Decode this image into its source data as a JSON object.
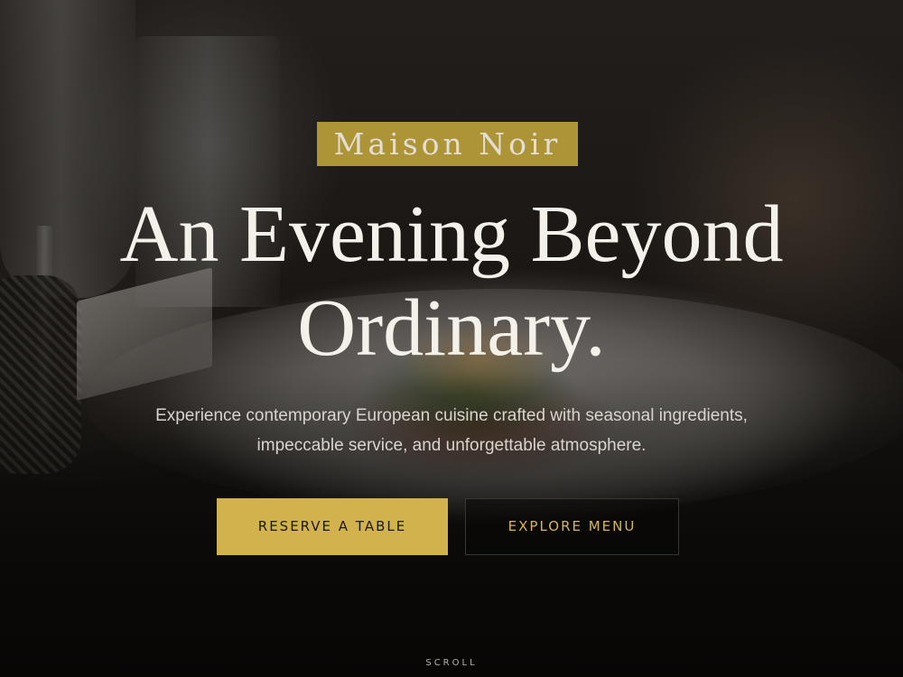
{
  "hero": {
    "brand_name": "Maison Noir",
    "headline_line1": "An Evening Beyond",
    "headline_line2": "Ordinary.",
    "subtitle_line1": "Experience contemporary European cuisine crafted with seasonal ingredients,",
    "subtitle_line2": "impeccable service, and unforgettable atmosphere.",
    "primary_button_label": "RESERVE A TABLE",
    "secondary_button_label": "EXPLORE MENU",
    "scroll_label": "SCROLL"
  },
  "colors": {
    "accent": "#d2b24c",
    "brand_badge": "#b99f3a",
    "text_light": "#f4f0ea"
  }
}
